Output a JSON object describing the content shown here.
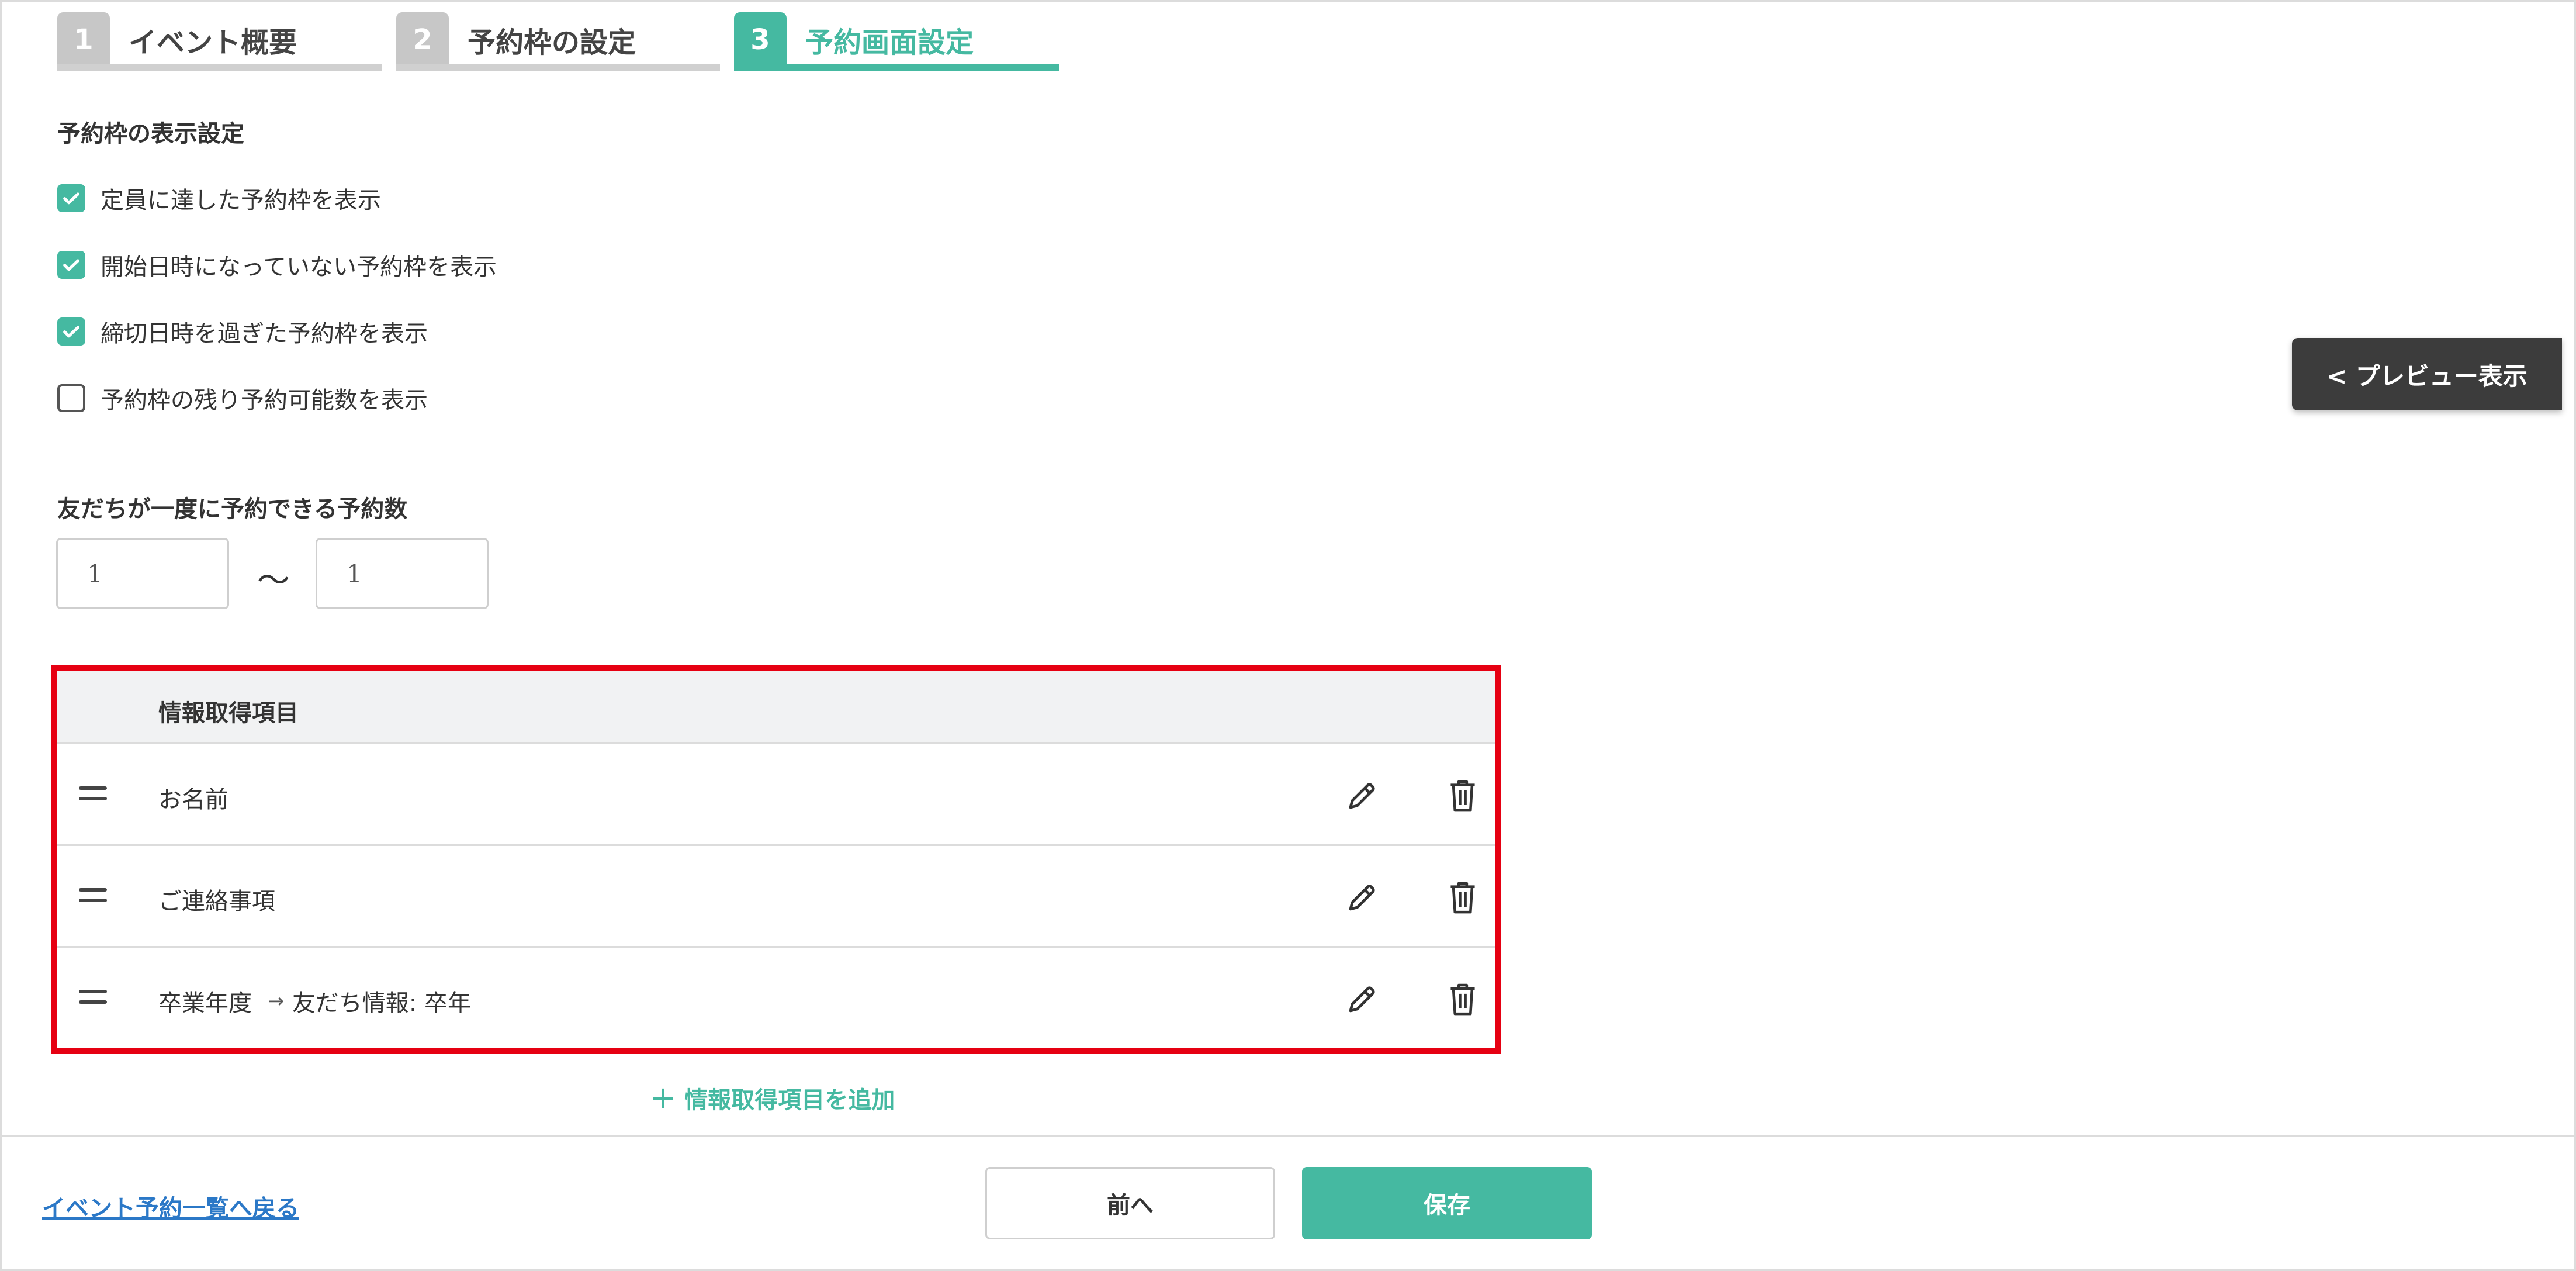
{
  "steps": [
    {
      "number": "1",
      "label": "イベント概要",
      "active": false
    },
    {
      "number": "2",
      "label": "予約枠の設定",
      "active": false
    },
    {
      "number": "3",
      "label": "予約画面設定",
      "active": true
    }
  ],
  "display_settings": {
    "title": "予約枠の表示設定",
    "options": [
      {
        "label": "定員に達した予約枠を表示",
        "checked": true
      },
      {
        "label": "開始日時になっていない予約枠を表示",
        "checked": true
      },
      {
        "label": "締切日時を過ぎた予約枠を表示",
        "checked": true
      },
      {
        "label": "予約枠の残り予約可能数を表示",
        "checked": false
      }
    ]
  },
  "reservation_count": {
    "title": "友だちが一度に予約できる予約数",
    "min": "1",
    "separator": "〜",
    "max": "1"
  },
  "info_table": {
    "header": "情報取得項目",
    "rows": [
      {
        "name": "お名前",
        "mapping": ""
      },
      {
        "name": "ご連絡事項",
        "mapping": ""
      },
      {
        "name": "卒業年度",
        "mapping": "友だち情報: 卒年"
      }
    ],
    "add_label": "情報取得項目を追加",
    "border_color": "#e60012"
  },
  "footer": {
    "back_link": "イベント予約一覧へ戻る",
    "prev_label": "前へ",
    "save_label": "保存"
  },
  "preview_button": "< プレビュー表示",
  "colors": {
    "accent": "#45b9a1",
    "link": "#2b78c7",
    "inactive_step": "#c7c7c7"
  }
}
